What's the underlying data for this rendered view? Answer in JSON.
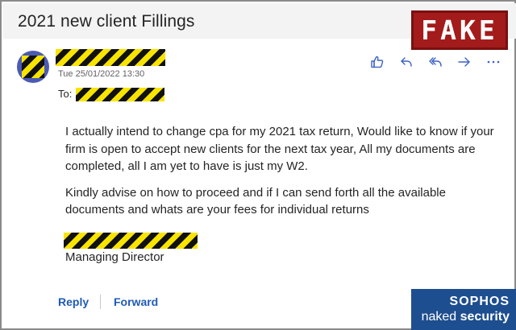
{
  "email": {
    "subject": "2021 new client Fillings",
    "timestamp": "Tue 25/01/2022 13:30",
    "to_label": "To:",
    "body": [
      "I actually intend to change cpa for my 2021 tax return, Would like to know if your firm is open to accept new clients for the next tax year, All my documents are completed, all I am yet to have is just my W2.",
      "Kindly advise on how to proceed and if I can send forth all the available documents and whats are your fees for individual returns"
    ],
    "signature_title": "Managing Director"
  },
  "actions": {
    "icons": [
      "like-icon",
      "reply-icon",
      "reply-all-icon",
      "forward-icon",
      "more-icon"
    ]
  },
  "footer": {
    "reply_label": "Reply",
    "forward_label": "Forward"
  },
  "overlay": {
    "stamp_text": "FAKE",
    "brand": "SOPHOS",
    "sub_normal": "naked ",
    "sub_bold": "security"
  },
  "colors": {
    "accent": "#3b63c4",
    "link": "#1f5bb5",
    "stamp": "#a31b1b",
    "badge": "#1d4e8f",
    "avatar": "#4b5bb3",
    "redaction_yellow": "#f7e400",
    "redaction_black": "#111111"
  }
}
